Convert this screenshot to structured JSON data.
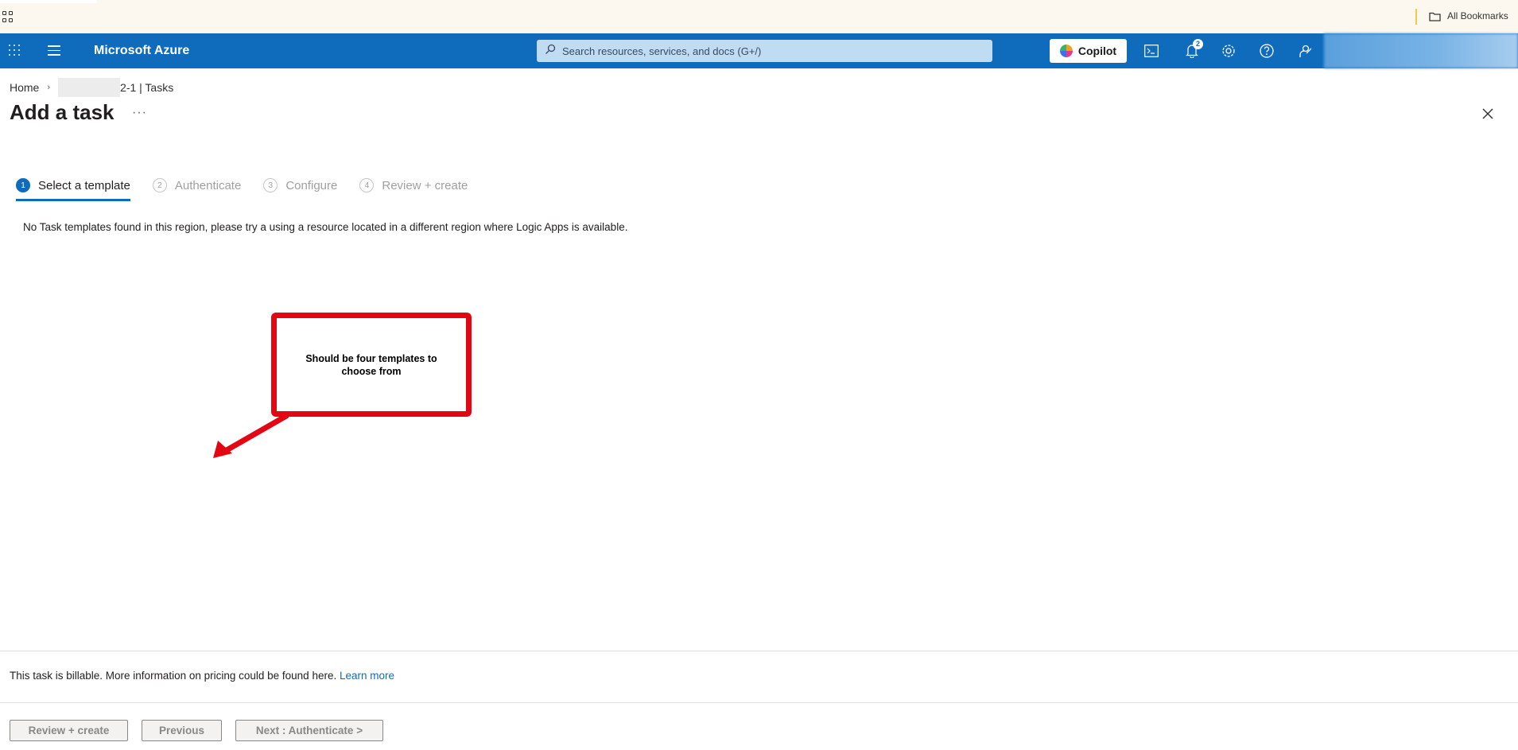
{
  "browser": {
    "all_bookmarks": "All Bookmarks"
  },
  "header": {
    "brand": "Microsoft Azure",
    "search_placeholder": "Search resources, services, and docs (G+/)",
    "copilot_label": "Copilot",
    "notifications_count": "2"
  },
  "breadcrumb": {
    "home": "Home",
    "resource": "2-1 | Tasks"
  },
  "page": {
    "title": "Add a task",
    "more": "···"
  },
  "steps": [
    {
      "number": "1",
      "label": "Select a template"
    },
    {
      "number": "2",
      "label": "Authenticate"
    },
    {
      "number": "3",
      "label": "Configure"
    },
    {
      "number": "4",
      "label": "Review + create"
    }
  ],
  "message": "No Task templates found in this region, please try a using a resource located in a different region where Logic Apps is available.",
  "annotation": {
    "text": "Should be four templates to choose from",
    "color": "#e30613"
  },
  "footer": {
    "billing_text": "This task is billable. More information on pricing could be found here.",
    "learn_more": "Learn more",
    "review_create": "Review + create",
    "previous": "Previous",
    "next": "Next : Authenticate >"
  },
  "colors": {
    "azure_blue": "#0f6cbd",
    "header_bg": "#0f6cbd"
  }
}
